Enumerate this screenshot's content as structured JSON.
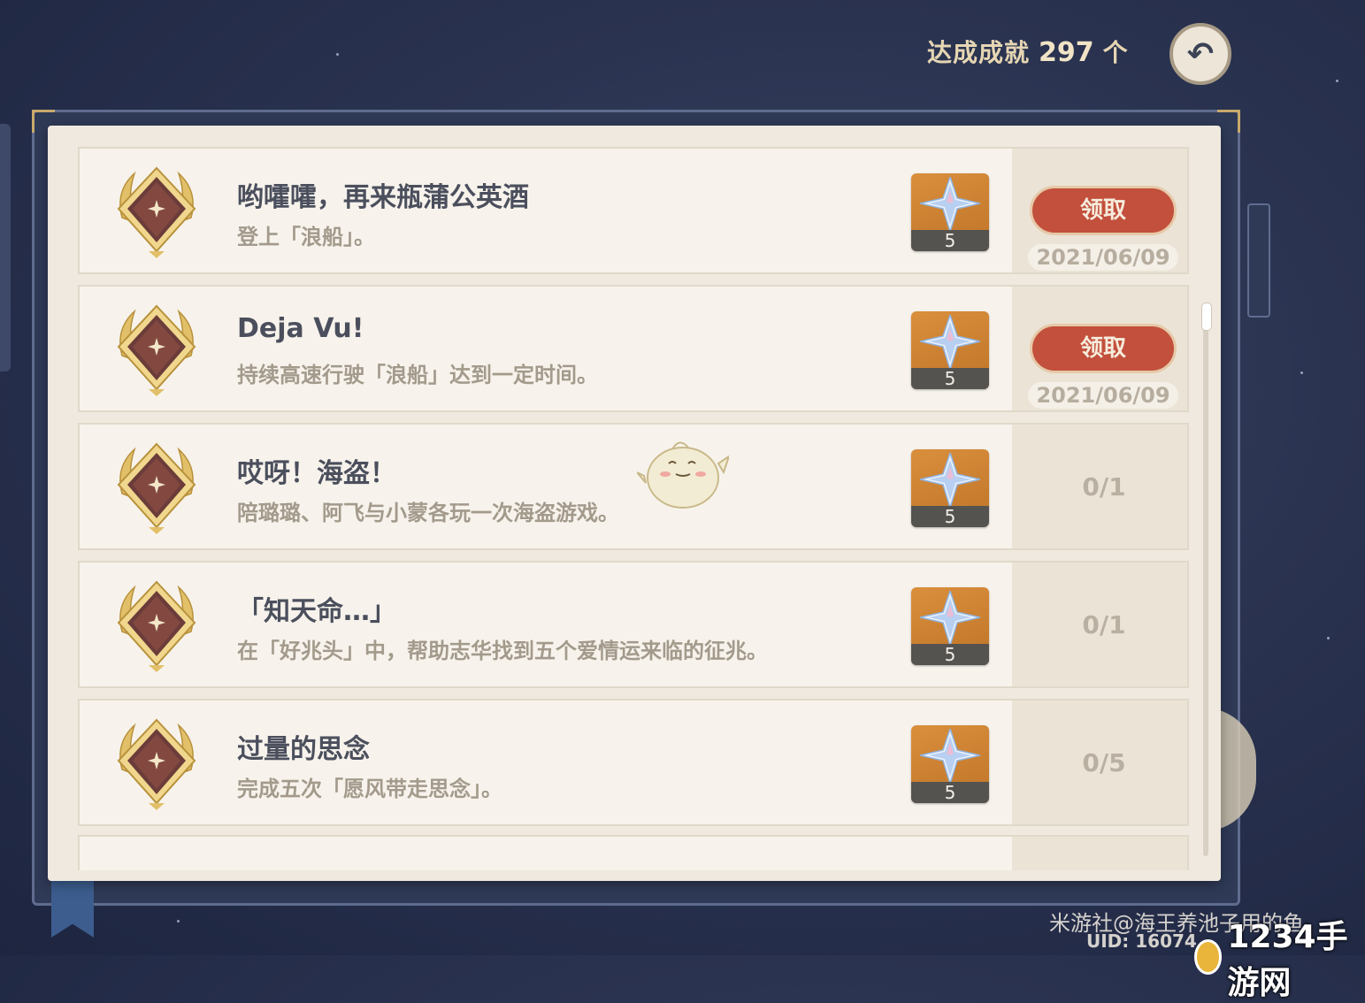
{
  "header": {
    "achieved_label": "达成成就",
    "achieved_count": "297",
    "achieved_unit": "个"
  },
  "achievements": [
    {
      "title": "哟嚯嚯，再来瓶蒲公英酒",
      "desc": "登上「浪船」。",
      "reward": "5",
      "status": "claim",
      "claim_label": "领取",
      "date": "2021/06/09"
    },
    {
      "title": "Deja Vu!",
      "desc": "持续高速行驶「浪船」达到一定时间。",
      "reward": "5",
      "status": "claim",
      "claim_label": "领取",
      "date": "2021/06/09"
    },
    {
      "title": "哎呀！海盗！",
      "desc": "陪璐璐、阿飞与小蒙各玩一次海盗游戏。",
      "reward": "5",
      "status": "progress",
      "progress": "0/1"
    },
    {
      "title": "「知天命…」",
      "desc": "在「好兆头」中，帮助志华找到五个爱情运来临的征兆。",
      "reward": "5",
      "status": "progress",
      "progress": "0/1"
    },
    {
      "title": "过量的思念",
      "desc": "完成五次「愿风带走思念」。",
      "reward": "5",
      "status": "progress",
      "progress": "0/5"
    }
  ],
  "watermark": {
    "line1": "米游社@海王养池子用的鱼",
    "line2": "UID: 16074",
    "site": "1234手游网"
  },
  "colors": {
    "claim_button": "#c2503c",
    "reward_bg": "#d98f3c",
    "paper": "#efe9df"
  }
}
